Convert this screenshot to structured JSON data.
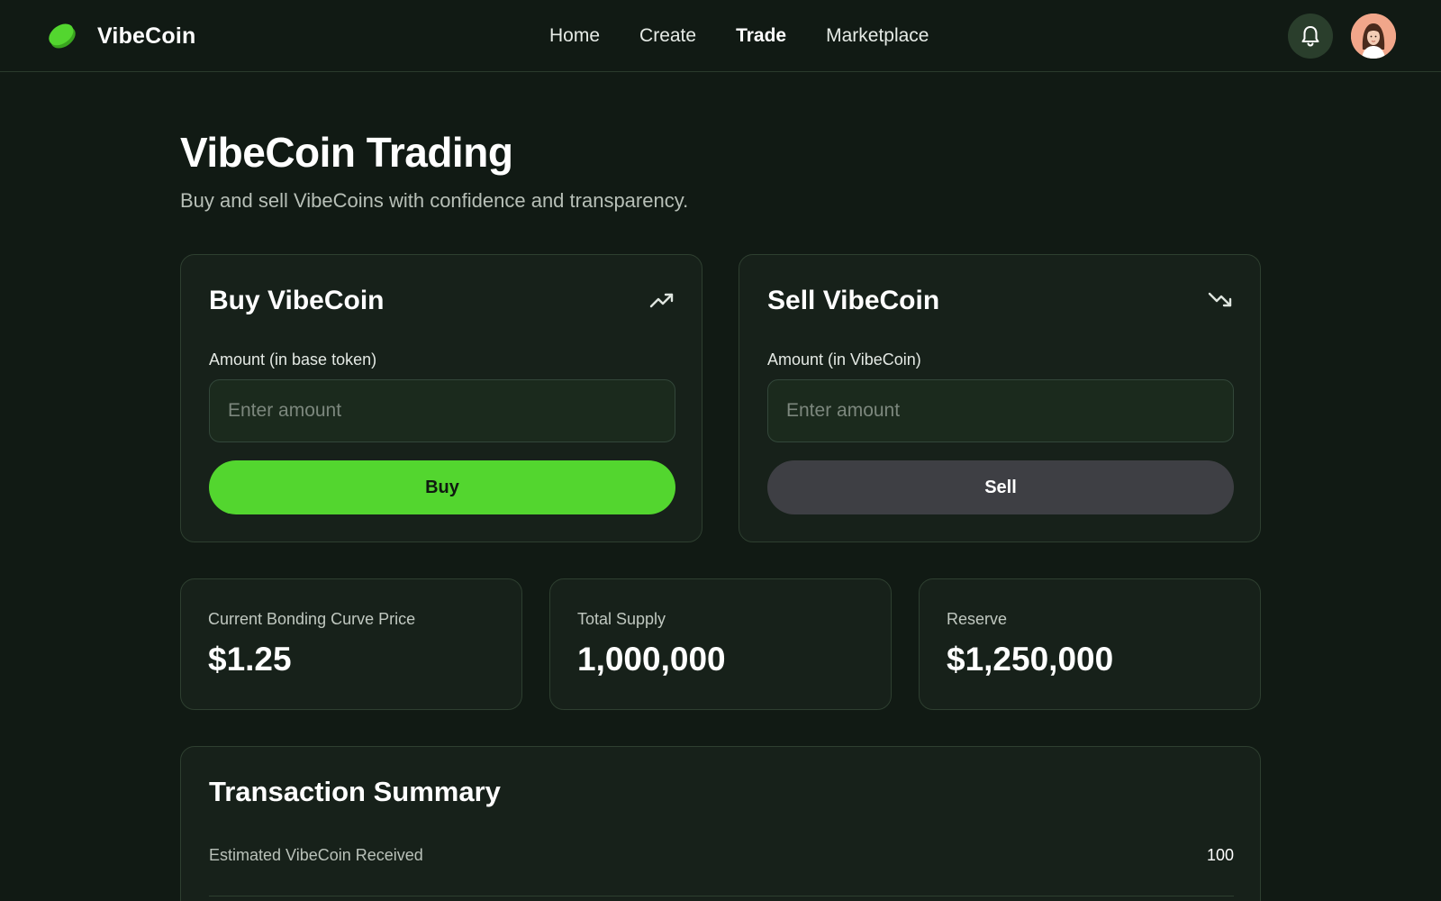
{
  "brand": {
    "name": "VibeCoin"
  },
  "nav": {
    "items": [
      "Home",
      "Create",
      "Trade",
      "Marketplace"
    ],
    "active": "Trade"
  },
  "header": {
    "notification_icon": "bell-icon",
    "avatar_icon": "user-avatar"
  },
  "page": {
    "title": "VibeCoin Trading",
    "subtitle": "Buy and sell VibeCoins with confidence and transparency."
  },
  "buy": {
    "title": "Buy VibeCoin",
    "icon": "trending-up-icon",
    "label": "Amount (in base token)",
    "placeholder": "Enter amount",
    "button": "Buy"
  },
  "sell": {
    "title": "Sell VibeCoin",
    "icon": "trending-down-icon",
    "label": "Amount (in VibeCoin)",
    "placeholder": "Enter amount",
    "button": "Sell"
  },
  "stats": [
    {
      "label": "Current Bonding Curve Price",
      "value": "$1.25"
    },
    {
      "label": "Total Supply",
      "value": "1,000,000"
    },
    {
      "label": "Reserve",
      "value": "$1,250,000"
    }
  ],
  "summary": {
    "title": "Transaction Summary",
    "rows": [
      {
        "label": "Estimated VibeCoin Received",
        "value": "100"
      }
    ]
  },
  "colors": {
    "background": "#111a14",
    "card": "#17211a",
    "accent": "#53d62f",
    "sell_button": "#3e3f44"
  }
}
